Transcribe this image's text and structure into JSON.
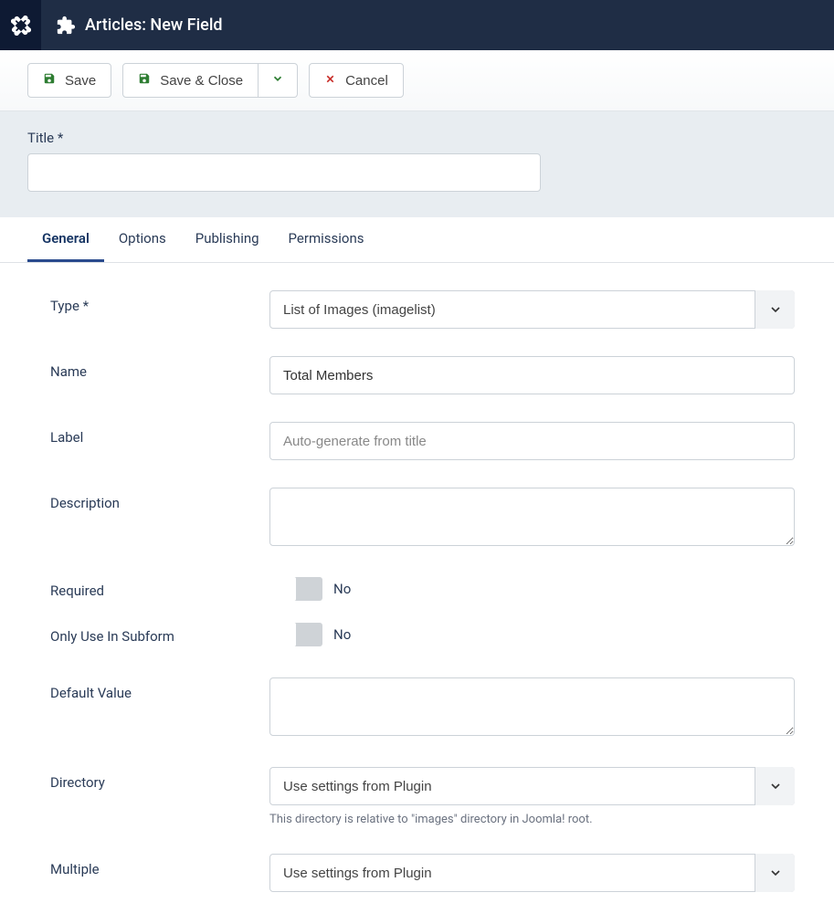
{
  "header": {
    "title": "Articles: New Field"
  },
  "toolbar": {
    "save": "Save",
    "save_close": "Save & Close",
    "cancel": "Cancel"
  },
  "title_field": {
    "label": "Title *",
    "value": ""
  },
  "tabs": [
    {
      "label": "General",
      "active": true
    },
    {
      "label": "Options",
      "active": false
    },
    {
      "label": "Publishing",
      "active": false
    },
    {
      "label": "Permissions",
      "active": false
    }
  ],
  "form": {
    "type": {
      "label": "Type *",
      "value": "List of Images (imagelist)"
    },
    "name": {
      "label": "Name",
      "value": "Total Members"
    },
    "label_field": {
      "label": "Label",
      "placeholder": "Auto-generate from title",
      "value": ""
    },
    "description": {
      "label": "Description",
      "value": ""
    },
    "required": {
      "label": "Required",
      "value": "No"
    },
    "only_subform": {
      "label": "Only Use In Subform",
      "value": "No"
    },
    "default_value": {
      "label": "Default Value",
      "value": ""
    },
    "directory": {
      "label": "Directory",
      "value": "Use settings from Plugin",
      "help": "This directory is relative to \"images\" directory in Joomla! root."
    },
    "multiple": {
      "label": "Multiple",
      "value": "Use settings from Plugin"
    }
  }
}
